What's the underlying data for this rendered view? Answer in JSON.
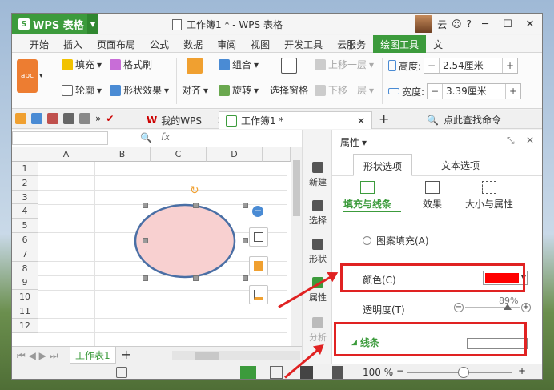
{
  "app": {
    "name": "WPS 表格",
    "doc_title": "工作簿1 * - WPS 表格",
    "user": "云"
  },
  "tabs": [
    "开始",
    "插入",
    "页面布局",
    "公式",
    "数据",
    "审阅",
    "视图",
    "开发工具",
    "云服务",
    "绘图工具",
    "文"
  ],
  "active_tab": "绘图工具",
  "ribbon": {
    "style_preview": "abc",
    "fill": "填充",
    "format_painter": "格式刷",
    "outline": "轮廓",
    "shape_effect": "形状效果",
    "align": "对齐",
    "group": "组合",
    "rotate": "旋转",
    "selection_pane": "选择窗格",
    "move_up": "上移一层",
    "move_down": "下移一层",
    "height_label": "高度:",
    "height_value": "2.54厘米",
    "width_label": "宽度:",
    "width_value": "3.39厘米",
    "minus": "−",
    "plus": "+"
  },
  "quickbar": {
    "tab_my_wps": "我的WPS",
    "tab_workbook": "工作簿1 *",
    "search": "点此查找命令"
  },
  "formula_bar": {
    "fx": "fx"
  },
  "sheet": {
    "columns": [
      "A",
      "B",
      "C",
      "D"
    ],
    "rows": [
      "1",
      "2",
      "3",
      "4",
      "5",
      "6",
      "7",
      "8",
      "9",
      "10",
      "11",
      "12"
    ],
    "sheet_tab": "工作表1",
    "add": "+"
  },
  "sidebar": {
    "new": "新建",
    "select": "选择",
    "shape": "形状",
    "property": "属性",
    "analyze": "分析"
  },
  "panel": {
    "title": "属性",
    "tab_shape": "形状选项",
    "tab_text": "文本选项",
    "sub_fill_line": "填充与线条",
    "sub_effect": "效果",
    "sub_size": "大小与属性",
    "pattern_fill": "图案填充(A)",
    "color_label": "颜色(C)",
    "color_value": "#ff0000",
    "transparency_label": "透明度(T)",
    "transparency_value": "89%",
    "line_section": "线条"
  },
  "status": {
    "zoom": "100 %"
  }
}
